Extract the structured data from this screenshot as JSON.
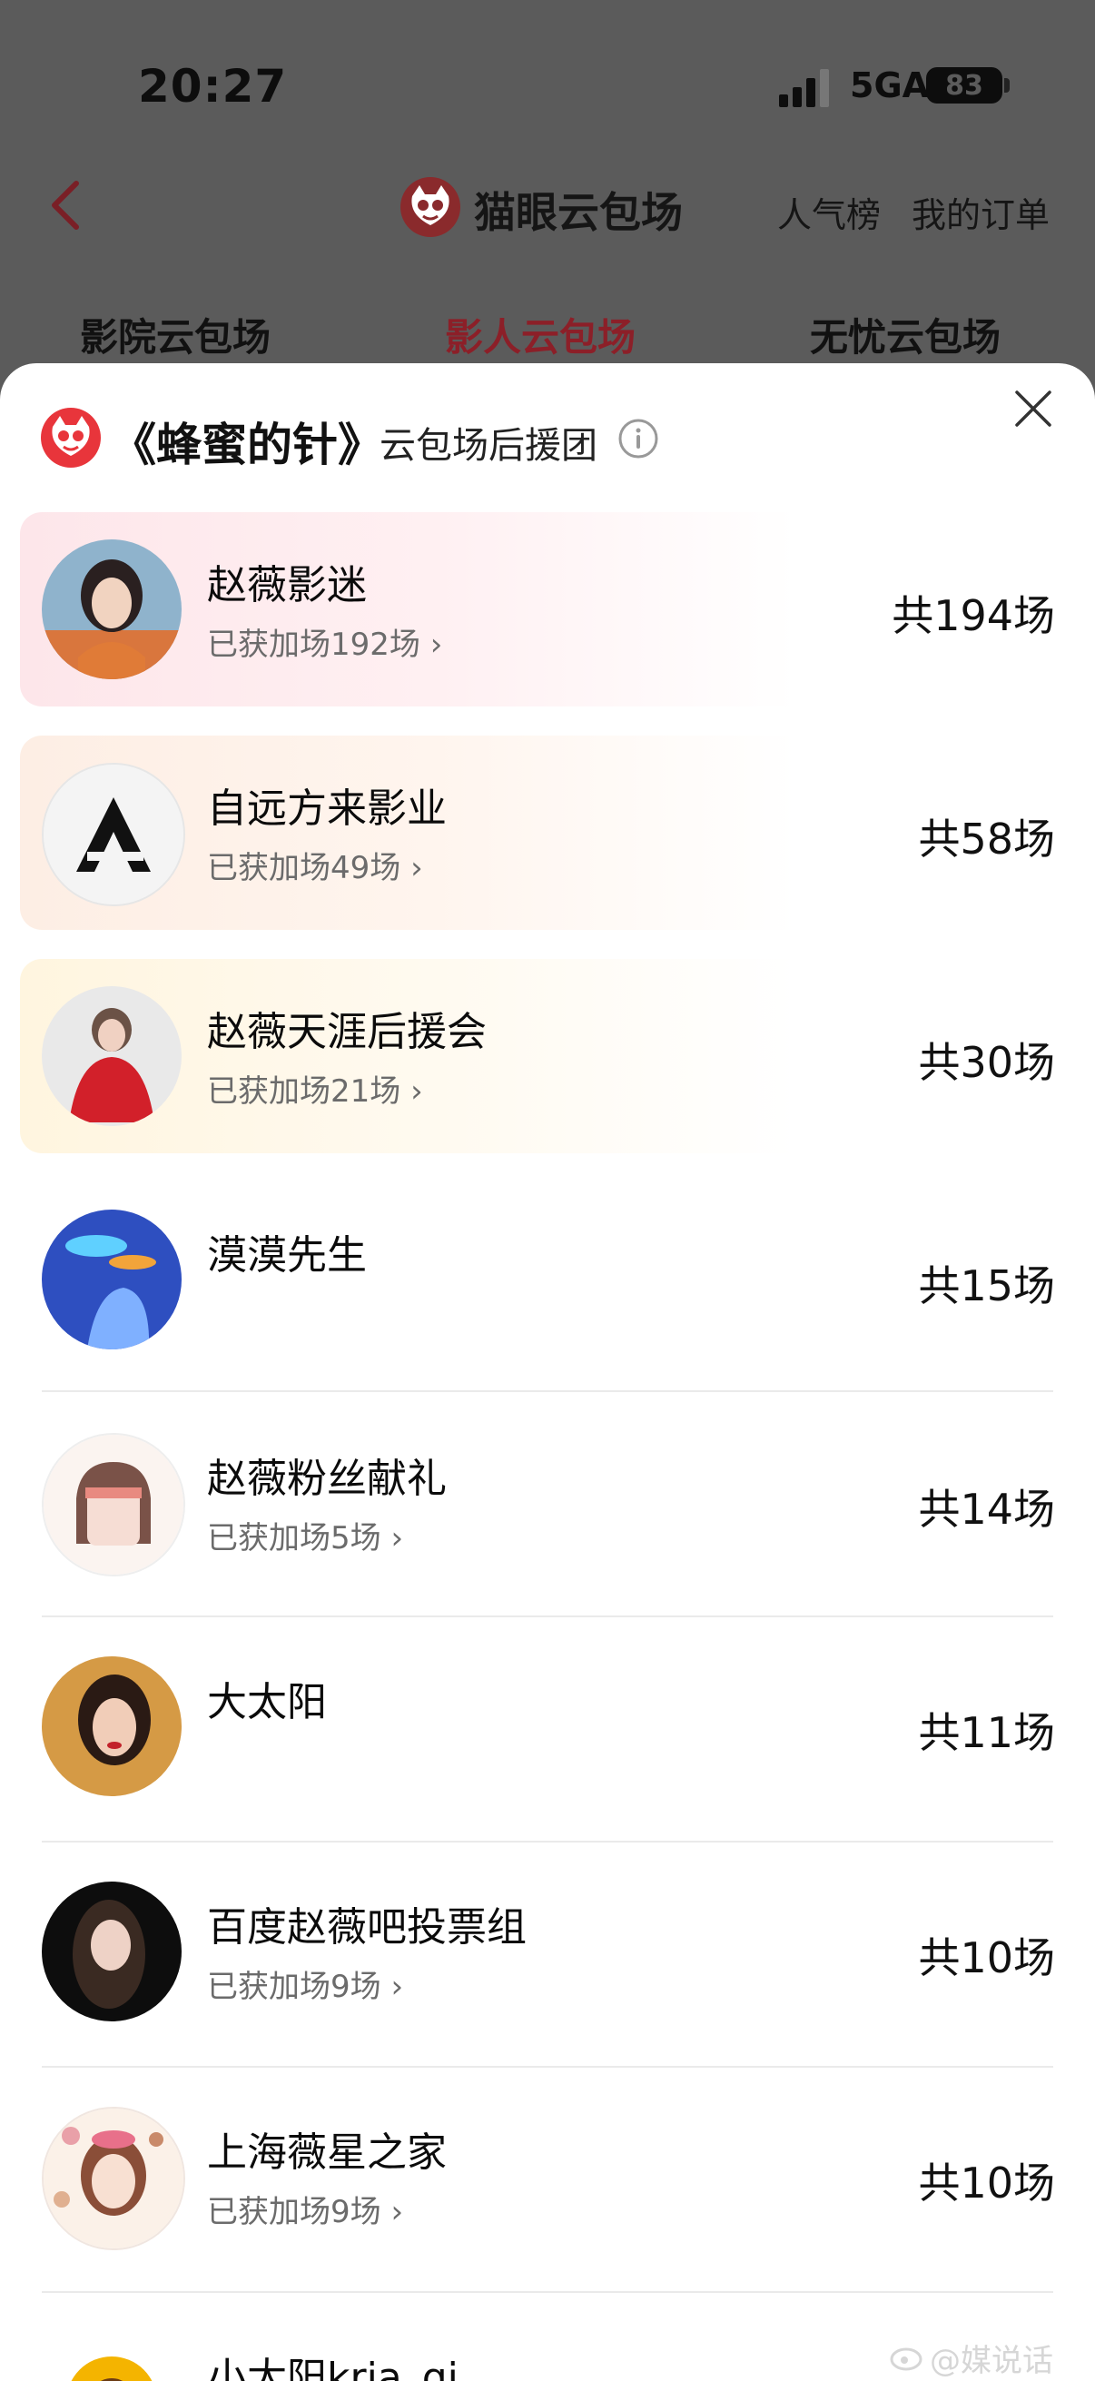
{
  "status_bar": {
    "time": "20:27",
    "network": "5GA",
    "battery": "83"
  },
  "nav": {
    "brand": "猫眼云包场",
    "links": [
      "人气榜",
      "我的订单"
    ]
  },
  "tabs": [
    {
      "label": "影院云包场",
      "active": false
    },
    {
      "label": "影人云包场",
      "active": true
    },
    {
      "label": "无忧云包场",
      "active": false
    }
  ],
  "sheet": {
    "title": "《蜂蜜的针》",
    "subtitle": "云包场后援团"
  },
  "list": [
    {
      "name": "赵薇影迷",
      "sub": "已获加场192场",
      "total": "共194场"
    },
    {
      "name": "自远方来影业",
      "sub": "已获加场49场",
      "total": "共58场"
    },
    {
      "name": "赵薇天涯后援会",
      "sub": "已获加场21场",
      "total": "共30场"
    },
    {
      "name": "漠漠先生",
      "sub": "",
      "total": "共15场"
    },
    {
      "name": "赵薇粉丝献礼",
      "sub": "已获加场5场",
      "total": "共14场"
    },
    {
      "name": "大太阳",
      "sub": "",
      "total": "共11场"
    },
    {
      "name": "百度赵薇吧投票组",
      "sub": "已获加场9场",
      "total": "共10场"
    },
    {
      "name": "上海薇星之家",
      "sub": "已获加场9场",
      "total": "共10场"
    },
    {
      "name": "小太阳kria_qi",
      "sub": "",
      "total": ""
    }
  ],
  "watermark": "@媒说话",
  "colors": {
    "accent": "#e8353b",
    "active_tab": "#8c1f28",
    "overlay": "#5b5b5b"
  }
}
